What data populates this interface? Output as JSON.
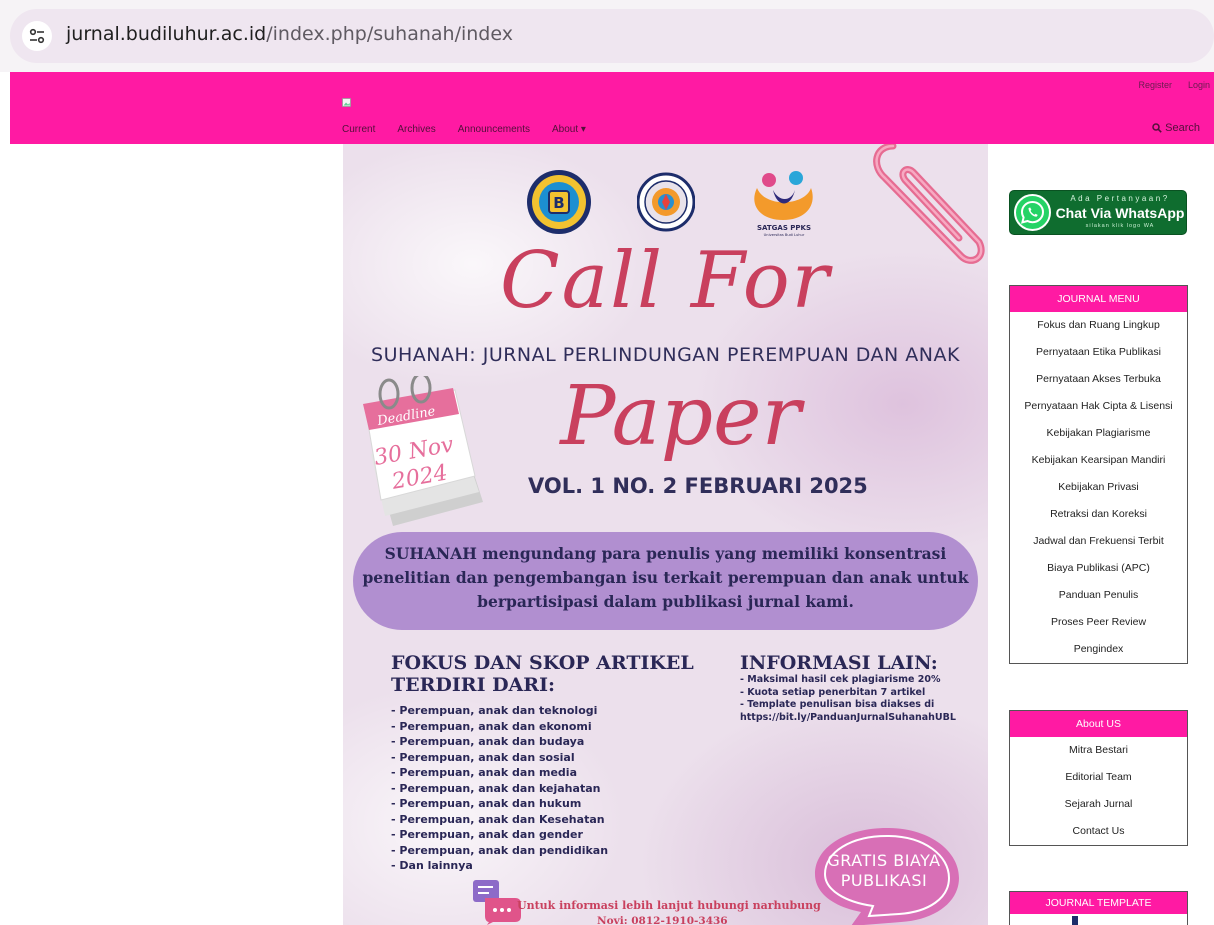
{
  "browser": {
    "url_domain": "jurnal.budiluhur.ac.id",
    "url_path": "/index.php/suhanah/index",
    "site_info_icon": "tune-icon"
  },
  "header": {
    "register": "Register",
    "login": "Login",
    "nav": [
      "Current",
      "Archives",
      "Announcements",
      "About ▾"
    ],
    "search": "Search",
    "bg_color": "#ff1aa3"
  },
  "poster": {
    "satgas_label": "SATGAS PPKS",
    "satgas_sub": "Universitas Budi Luhur",
    "call_for": "Call For",
    "journal_title": "SUHANAH: JURNAL PERLINDUNGAN PEREMPUAN DAN ANAK",
    "paper": "Paper",
    "deadline_label": "Deadline",
    "deadline_day": "30 Nov",
    "deadline_year": "2024",
    "volume": "VOL. 1 NO. 2 FEBRUARI 2025",
    "invitation": "SUHANAH mengundang para penulis yang memiliki konsentrasi penelitian dan pengembangan isu terkait perempuan dan anak untuk berpartisipasi dalam publikasi jurnal kami.",
    "fokus_heading_1": "FOKUS DAN SKOP ARTIKEL",
    "fokus_heading_2": "TERDIRI DARI:",
    "fokus_items": [
      "- Perempuan, anak dan teknologi",
      "- Perempuan, anak dan ekonomi",
      "- Perempuan, anak dan budaya",
      "- Perempuan, anak dan sosial",
      "- Perempuan, anak dan media",
      "- Perempuan, anak dan kejahatan",
      "- Perempuan, anak dan hukum",
      "- Perempuan, anak dan Kesehatan",
      "- Perempuan, anak dan gender",
      "- Perempuan, anak dan pendidikan",
      "- Dan lainnya"
    ],
    "info_heading": "INFORMASI LAIN:",
    "info_items": [
      "- Maksimal hasil cek plagiarisme 20%",
      "- Kuota setiap penerbitan 7 artikel",
      "- Template penulisan bisa diakses di",
      "https://bit.ly/PanduanJurnalSuhanahUBL"
    ],
    "gratis_1": "GRATIS BIAYA",
    "gratis_2": "PUBLIKASI",
    "contact_1": "Untuk informasi lebih lanjut hubungi narhubung",
    "contact_2": "Novi: 0812-1910-3436"
  },
  "sidebar": {
    "whatsapp": {
      "small": "Ada Pertanyaan?",
      "big": "Chat Via WhatsApp",
      "tiny": "silakan klik logo WA"
    },
    "journal_menu": {
      "title": "JOURNAL MENU",
      "items": [
        "Fokus dan Ruang Lingkup",
        "Pernyataan Etika Publikasi",
        "Pernyataan Akses Terbuka",
        "Pernyataan Hak Cipta & Lisensi",
        "Kebijakan Plagiarisme",
        "Kebijakan Kearsipan Mandiri",
        "Kebijakan Privasi",
        "Retraksi dan Koreksi",
        "Jadwal dan Frekuensi Terbit",
        "Biaya Publikasi (APC)",
        "Panduan Penulis",
        "Proses Peer Review",
        "Pengindex"
      ]
    },
    "about_us": {
      "title": "About US",
      "items": [
        "Mitra Bestari",
        "Editorial Team",
        "Sejarah Jurnal",
        "Contact Us"
      ]
    },
    "journal_template": {
      "title": "JOURNAL TEMPLATE"
    }
  }
}
